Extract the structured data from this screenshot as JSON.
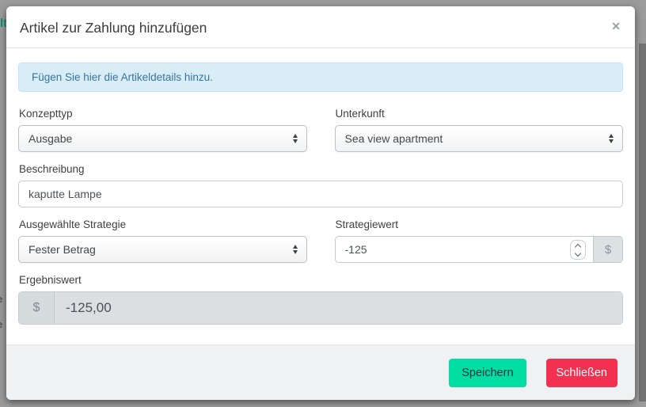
{
  "background": {
    "fragments": [
      "lt",
      "e",
      "e"
    ]
  },
  "modal": {
    "title": "Artikel zur Zahlung hinzufügen",
    "close_icon": "✕",
    "alert_text": "Fügen Sie hier die Artikeldetails hinzu.",
    "fields": {
      "konzepttyp": {
        "label": "Konzepttyp",
        "value": "Ausgabe"
      },
      "unterkunft": {
        "label": "Unterkunft",
        "value": "Sea view apartment"
      },
      "beschreibung": {
        "label": "Beschreibung",
        "value": "kaputte Lampe"
      },
      "strategie": {
        "label": "Ausgewählte Strategie",
        "value": "Fester Betrag"
      },
      "strategiewert": {
        "label": "Strategiewert",
        "value": "-125",
        "currency": "$"
      },
      "ergebniswert": {
        "label": "Ergebniswert",
        "value": "-125,00",
        "currency": "$"
      }
    },
    "footer": {
      "save_label": "Speichern",
      "close_label": "Schließen"
    }
  },
  "colors": {
    "save_button": "#00dfa3",
    "close_button": "#f3304f",
    "alert_bg": "#d9edf7",
    "alert_text": "#37759d",
    "backdrop": "#9b9b9b",
    "teal_link": "#148f77"
  }
}
